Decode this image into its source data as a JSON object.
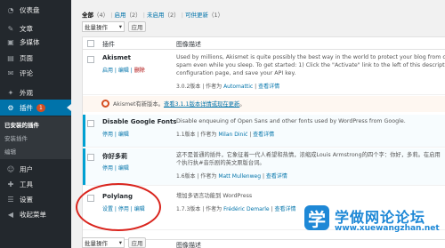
{
  "sidebar": {
    "items": [
      {
        "label": "仪表盘",
        "icon": "dashboard-icon",
        "glyph": "◔"
      },
      {
        "label": "文章",
        "icon": "pin-icon",
        "glyph": "✎"
      },
      {
        "label": "多媒体",
        "icon": "media-icon",
        "glyph": "▣"
      },
      {
        "label": "页面",
        "icon": "page-icon",
        "glyph": "▤"
      },
      {
        "label": "评论",
        "icon": "comment-icon",
        "glyph": "✉"
      },
      {
        "label": "外观",
        "icon": "appearance-icon",
        "glyph": "✦"
      },
      {
        "label": "插件",
        "icon": "plugin-icon",
        "glyph": "⚙",
        "badge": "1"
      },
      {
        "label": "用户",
        "icon": "users-icon",
        "glyph": "☺"
      },
      {
        "label": "工具",
        "icon": "tools-icon",
        "glyph": "✚"
      },
      {
        "label": "设置",
        "icon": "settings-icon",
        "glyph": "☰"
      },
      {
        "label": "收起菜单",
        "icon": "collapse-icon",
        "glyph": "◀"
      }
    ],
    "submenu": [
      "已安装的插件",
      "安装插件",
      "编辑"
    ]
  },
  "filters": {
    "all": "全部",
    "all_count": "（4）",
    "active": "启用",
    "active_count": "（2）",
    "inactive": "未启用",
    "inactive_count": "（2）",
    "update": "可供更新",
    "update_count": "（1）",
    "sep": "|"
  },
  "bulk": {
    "label": "批量操作",
    "apply": "应用"
  },
  "table": {
    "col_plugin": "插件",
    "col_desc": "图像描述",
    "rows": [
      {
        "name": "Akismet",
        "actions": [
          "启用",
          "编辑",
          "删除"
        ],
        "desc1": "Used by millions, Akismet is quite possibly the best way in the world to protect your blog from comment",
        "desc2": "spam even while you sleep. To get started: 1) Click the \"Activate\" link to the left of this description, 2) Sign",
        "desc3": "configuration page, and save your API key.",
        "version": "3.0.2版本",
        "author_prefix": "| 作者为",
        "author": "Automattic",
        "sep": "|",
        "details": "查看详情"
      },
      {
        "name": "Disable Google Fonts",
        "actions": [
          "停用",
          "编辑"
        ],
        "desc1": "Disable enqueuing of Open Sans and other fonts used by WordPress from Google.",
        "version": "1.1版本",
        "author_prefix": "| 作者为",
        "author": "Milan Dinić",
        "sep": "|",
        "details": "查看详情"
      },
      {
        "name": "你好多莉",
        "actions": [
          "停用",
          "编辑"
        ],
        "desc1": "这不是普通的插件，它象征着一代人希望和热情，浓缩成Louis Armstrong的四个字：你好，多莉。在启用",
        "desc2": "个执行执#音乐剧的英文原版台词。",
        "version": "1.6版本",
        "author_prefix": "| 作者为",
        "author": "Matt Mullenweg",
        "sep": "|",
        "details": "查看详情"
      },
      {
        "name": "Polylang",
        "actions": [
          "设置",
          "停用",
          "编辑"
        ],
        "desc1": "增加多语言功能到 WordPress",
        "version": "1.7.3版本",
        "author_prefix": "| 作者为",
        "author": "Frédéric Demarle",
        "sep": "|",
        "details": "查看详情"
      }
    ],
    "update_notice": {
      "text": "Akismet有新版本。",
      "link": "查看3.1.1版本详情或现在更新",
      "suffix": "。"
    }
  },
  "watermark": {
    "glyph": "学",
    "cn": "学做网论论坛",
    "url": "www.xuewangzhan.net"
  },
  "colors": {
    "accent": "#0073aa",
    "sidebar": "#23282d",
    "highlight": "#d9241d",
    "brand": "#1e88d6"
  }
}
